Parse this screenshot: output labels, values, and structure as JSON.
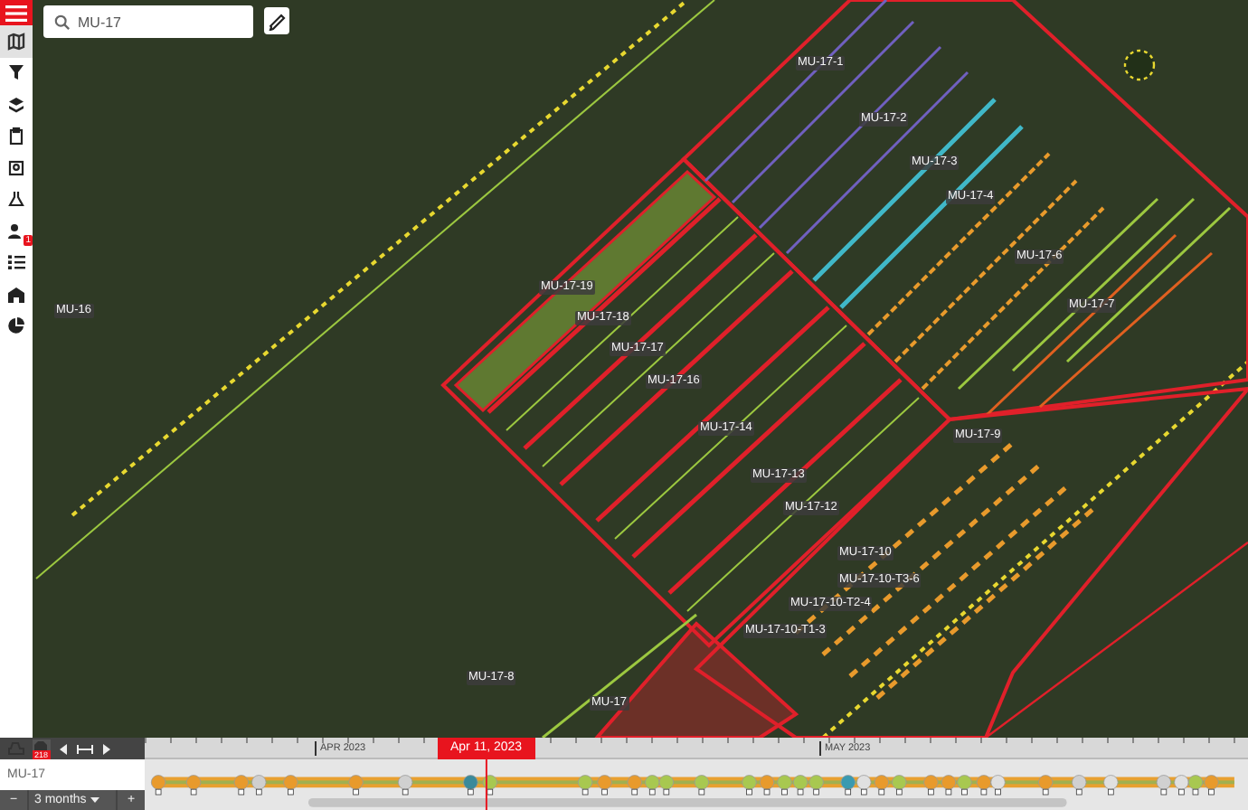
{
  "search": {
    "value": "MU-17"
  },
  "sidebar": {
    "items": [
      {
        "selected": true
      },
      {
        "selected": false
      },
      {
        "selected": false
      },
      {
        "selected": false
      },
      {
        "selected": false
      },
      {
        "selected": false
      },
      {
        "selected": false,
        "badge": "1"
      },
      {
        "selected": false
      },
      {
        "selected": false
      },
      {
        "selected": false
      }
    ]
  },
  "map": {
    "labels": [
      "MU-17-1",
      "MU-17-2",
      "MU-17-3",
      "MU-17-4",
      "MU-17-6",
      "MU-16",
      "MU-17-19",
      "MU-17-7",
      "MU-17-18",
      "MU-17-17",
      "MU-17-16",
      "MU-17-9",
      "MU-17-14",
      "MU-17-13",
      "MU-17-12",
      "MU-17-10",
      "MU-17-10-T3-6",
      "MU-17-10-T2-4",
      "MU-17-10-T1-3",
      "MU-17-8",
      "MU-17"
    ]
  },
  "timeline": {
    "alert_count": "218",
    "field": "MU-17",
    "months": [
      "APR 2023",
      "MAY 2023"
    ],
    "current_date": "Apr 11, 2023",
    "zoom_out": "−",
    "range": "3 months",
    "zoom_in": "+"
  }
}
